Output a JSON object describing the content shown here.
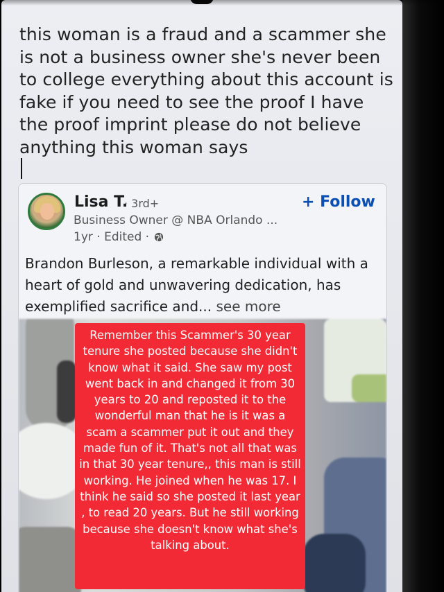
{
  "comment": {
    "text": "this woman is a fraud and a scammer she is not a business owner she's never been to college everything about this account is fake if you need to see the proof I have the proof imprint please do not believe anything this woman says"
  },
  "post": {
    "author_name": "Lisa T.",
    "degree": "· 3rd+",
    "follow_label": "+ Follow",
    "headline": "Business Owner @ NBA Orlando ...",
    "meta": "1yr · Edited ·",
    "body": "Brandon Burleson, a remarkable individual with a heart of gold and unwavering dedication, has exemplified sacrifice and...",
    "see_more_label": "see more",
    "avatar_icon": "profile-photo-opentowork"
  },
  "overlay": {
    "text": "Remember this Scammer's 30 year tenure she posted because she didn't know what it said. She saw my post went back in and changed it from 30 years to 20 and reposted it to the wonderful man that he is it was a scam a scammer put it out and they made fun of it. That's not all that was in that 30 year tenure,, this man is still working. He joined when he was 17. I think he said so she posted it last year , to read 20 years. But he still working because she doesn't know what she's talking about.",
    "background_color": "#f12a35"
  },
  "colors": {
    "follow_blue": "#0a4fb3",
    "avatar_ring": "#2f7a3c"
  }
}
